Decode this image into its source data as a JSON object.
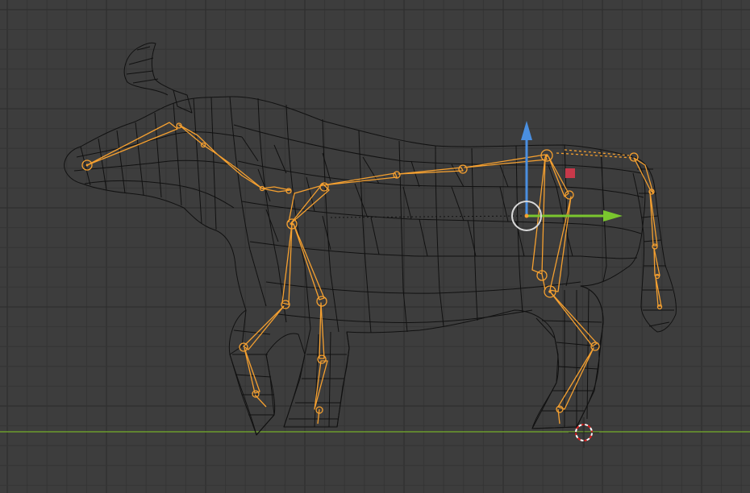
{
  "viewport": {
    "background_color": "#3d3d3d",
    "grid_minor_color": "#353535",
    "grid_major_color": "#2c2c2c",
    "ground_axis_color": "#6c9c2c",
    "mesh_wire_color": "#111111",
    "armature_color": "#f5a030",
    "object_name": "bull",
    "mode": "pose"
  },
  "gizmo": {
    "z_axis_color": "#4a8fe0",
    "y_axis_color": "#7ac62e",
    "x_axis_color": "#c8394a",
    "pivot_color": "#d9d9d9",
    "pivot_dot_color": "#f5a030"
  },
  "cursor_3d": {
    "ring_color_a": "#e02020",
    "ring_color_b": "#ffffff"
  }
}
